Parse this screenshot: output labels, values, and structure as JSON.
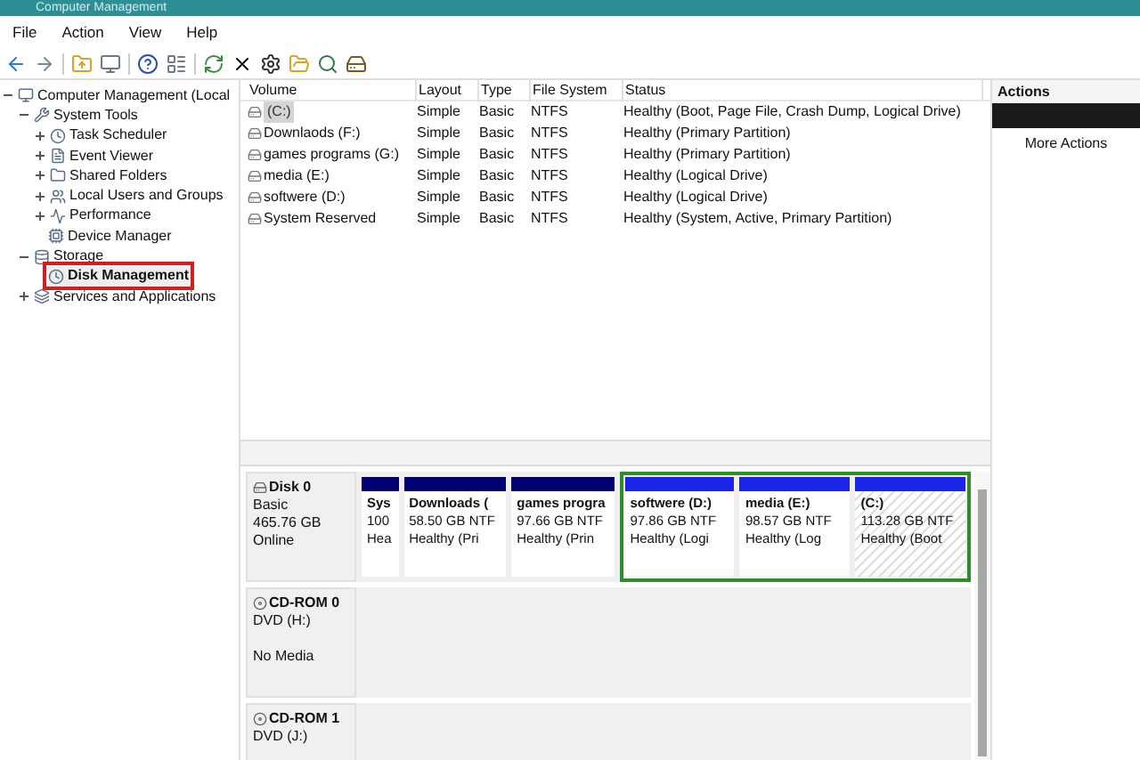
{
  "window": {
    "title": "Computer Management"
  },
  "menu": [
    "File",
    "Action",
    "View",
    "Help"
  ],
  "tree": {
    "label": "Computer Management (Local",
    "expanded": true,
    "children": [
      {
        "label": "System Tools",
        "expanded": true,
        "selected": false,
        "children": [
          {
            "label": "Task Scheduler",
            "expanded": false,
            "selected": false
          },
          {
            "label": "Event Viewer",
            "expanded": false,
            "selected": false
          },
          {
            "label": "Shared Folders",
            "expanded": false,
            "selected": false
          },
          {
            "label": "Local Users and Groups",
            "expanded": false,
            "selected": false
          },
          {
            "label": "Performance",
            "expanded": false,
            "selected": false
          },
          {
            "label": "Device Manager",
            "selected": false
          }
        ]
      },
      {
        "label": "Storage",
        "expanded": true,
        "selected": false,
        "children": [
          {
            "label": "Disk Management",
            "selected": true
          }
        ]
      },
      {
        "label": "Services and Applications",
        "expanded": false,
        "selected": false
      }
    ]
  },
  "table": {
    "columns": [
      "Volume",
      "Layout",
      "Type",
      "File System",
      "Status"
    ],
    "rows": [
      {
        "cells": [
          "(C:)",
          "Simple",
          "Basic",
          "NTFS",
          "Healthy (Boot, Page File, Crash Dump, Logical Drive)"
        ],
        "selected": true
      },
      {
        "cells": [
          "Downlaods (F:)",
          "Simple",
          "Basic",
          "NTFS",
          "Healthy (Primary Partition)"
        ],
        "selected": false
      },
      {
        "cells": [
          "games programs (G:)",
          "Simple",
          "Basic",
          "NTFS",
          "Healthy (Primary Partition)"
        ],
        "selected": false
      },
      {
        "cells": [
          "media (E:)",
          "Simple",
          "Basic",
          "NTFS",
          "Healthy (Logical Drive)"
        ],
        "selected": false
      },
      {
        "cells": [
          "softwere (D:)",
          "Simple",
          "Basic",
          "NTFS",
          "Healthy (Logical Drive)"
        ],
        "selected": false
      },
      {
        "cells": [
          "System Reserved",
          "Simple",
          "Basic",
          "NTFS",
          "Healthy (System, Active, Primary Partition)"
        ],
        "selected": false
      }
    ]
  },
  "disks": [
    {
      "kind": "disk",
      "name": "Disk 0",
      "lines": [
        "Basic",
        "465.76 GB",
        "Online"
      ],
      "partitions": [
        {
          "kind": "primary",
          "lines": [
            "Sys",
            "100",
            "Hea"
          ],
          "selected": false
        },
        {
          "kind": "primary",
          "lines": [
            "Downloads (",
            "58.50 GB NTF",
            "Healthy (Pri"
          ],
          "selected": false
        },
        {
          "kind": "primary",
          "lines": [
            "games progra",
            "97.66 GB NTF",
            "Healthy (Prin"
          ],
          "selected": false
        },
        {
          "kind": "logical",
          "lines": [
            "softwere (D:)",
            "97.86 GB NTF",
            "Healthy (Logi"
          ],
          "selected": false
        },
        {
          "kind": "logical",
          "lines": [
            "media (E:)",
            "98.57 GB NTF",
            "Healthy (Log"
          ],
          "selected": false
        },
        {
          "kind": "logical",
          "lines": [
            "(C:)",
            "113.28 GB NTF",
            "Healthy (Boot"
          ],
          "selected": true
        }
      ]
    },
    {
      "kind": "cdrom",
      "name": "CD-ROM 0",
      "lines": [
        "DVD (H:)"
      ],
      "media": "No Media"
    },
    {
      "kind": "cdrom",
      "name": "CD-ROM 1",
      "lines": [
        "DVD (J:)"
      ]
    }
  ],
  "actions": {
    "title": "Actions",
    "items": [
      "More Actions"
    ]
  }
}
